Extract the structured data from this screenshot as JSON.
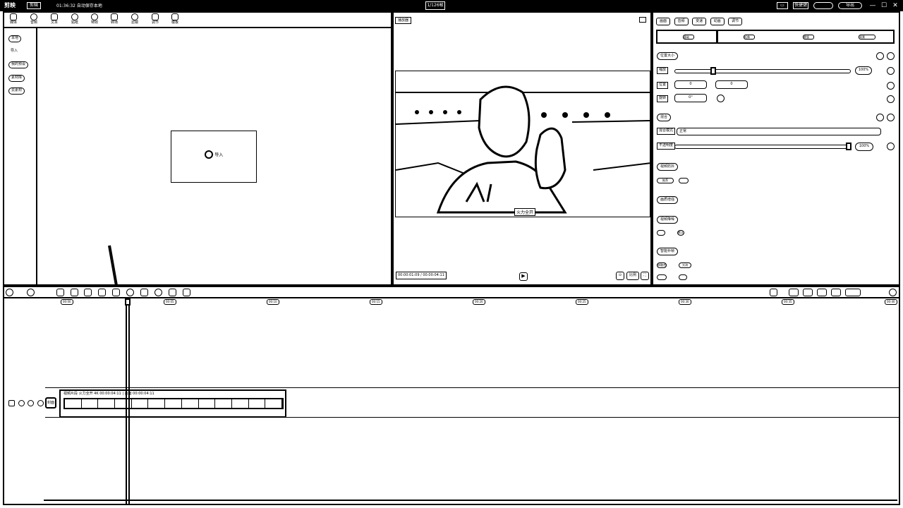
{
  "titlebar": {
    "logo": "剪映",
    "project_label": "剪辑",
    "timer": "01:36:32 自动保存本地",
    "center_label": "1/126帧",
    "buttons": [
      "▭",
      "快捷键",
      "导出"
    ],
    "window_controls": [
      "—",
      "☐",
      "✕"
    ]
  },
  "media": {
    "tools": [
      {
        "label": "媒体",
        "icon": "media-icon"
      },
      {
        "label": "音频",
        "icon": "audio-icon"
      },
      {
        "label": "文本",
        "icon": "text-icon"
      },
      {
        "label": "贴纸",
        "icon": "sticker-icon"
      },
      {
        "label": "特效",
        "icon": "effects-icon"
      },
      {
        "label": "转场",
        "icon": "transition-icon"
      },
      {
        "label": "滤镜",
        "icon": "filter-icon"
      },
      {
        "label": "调节",
        "icon": "adjust-icon"
      },
      {
        "label": "模板",
        "icon": "template-icon"
      }
    ],
    "side": [
      "本地",
      "导入",
      "我的预设",
      "素材库",
      "云素材"
    ],
    "import_label": "导入"
  },
  "preview": {
    "title": "播放器",
    "caption": "火力全开",
    "timecode": "00:00:01:09 / 00:00:04:11",
    "play_icon": "▶",
    "right_buttons": [
      "⊙",
      "比例",
      "⛶"
    ]
  },
  "props": {
    "tabs": [
      "画面",
      "音频",
      "变速",
      "动画",
      "调节"
    ],
    "segments": [
      "基础",
      "抠像",
      "蒙版",
      "背景"
    ],
    "sections": {
      "position_size": "位置大小",
      "scale_label": "缩放",
      "scale_value": "100%",
      "position_label": "位置",
      "pos_x": "0",
      "pos_y": "0",
      "rotate_label": "旋转",
      "rotate_value": "0°",
      "blend": "混合",
      "blend_mode_label": "混合模式",
      "blend_mode_value": "正常",
      "opacity_label": "不透明度",
      "opacity_value": "100%",
      "stabilize": "视频防抖",
      "stabilize_opt": "推荐",
      "enhance": "画质增强",
      "denoise": "视频降噪",
      "denoise_opt": "默认",
      "smart": "智能补帧",
      "smart_opt_a": "帧融合",
      "smart_opt_b": "光流"
    }
  },
  "timeline": {
    "ruler": [
      "00:00",
      "00:05",
      "00:10",
      "00:15",
      "00:20",
      "00:25",
      "00:30",
      "00:35",
      "00:40"
    ],
    "clip_name": "视频片段 火力全开 4K 00:00:04:11 | 画面 00:00:04:11",
    "cover_label": "封面"
  }
}
